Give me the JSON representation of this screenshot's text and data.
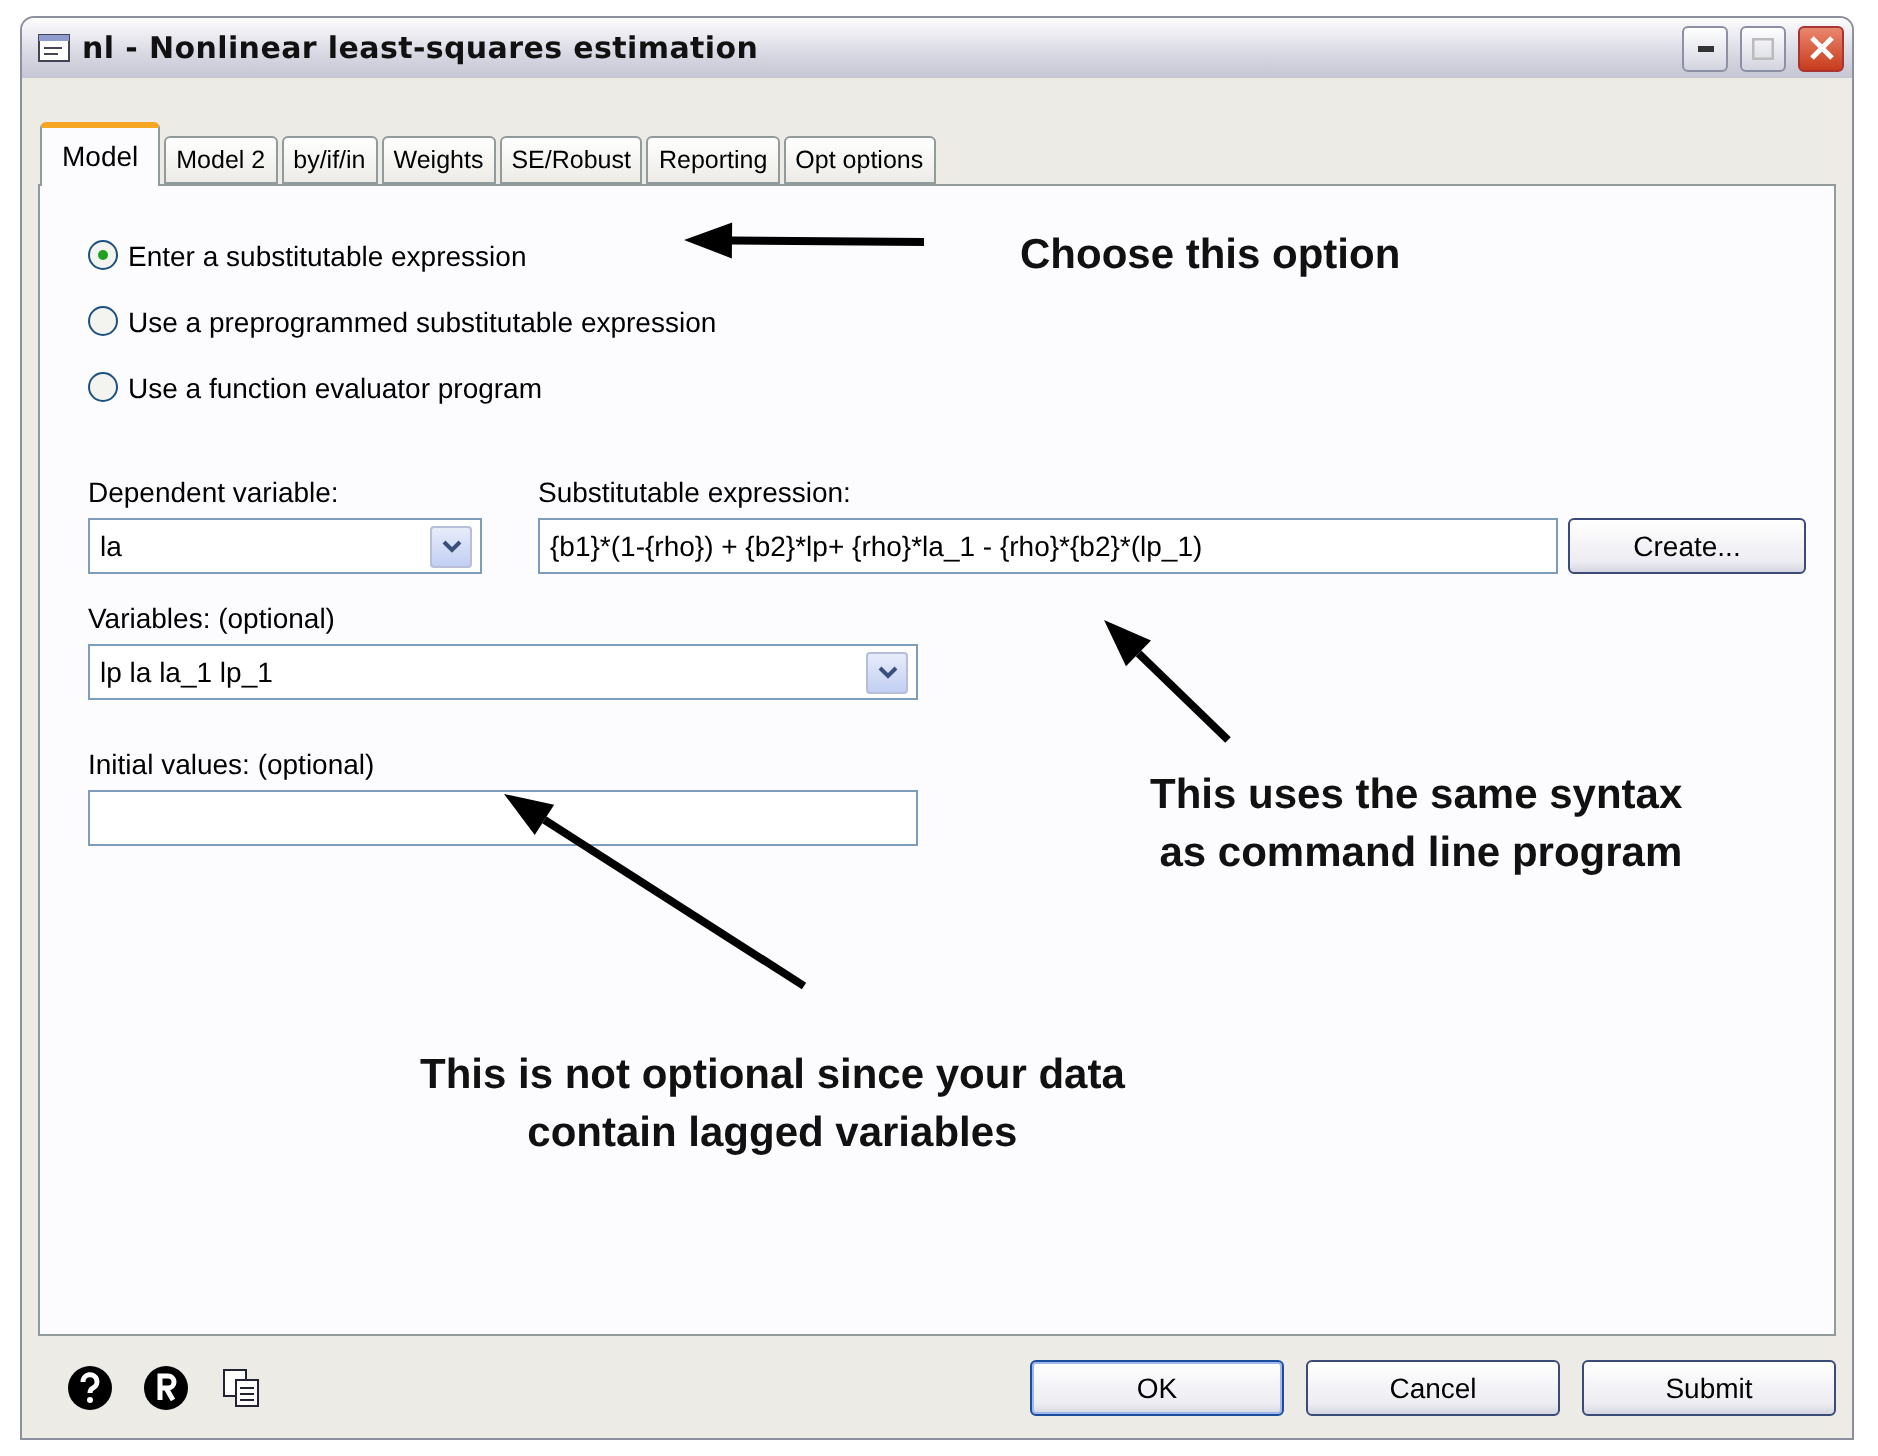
{
  "window": {
    "title": "nl - Nonlinear least-squares estimation"
  },
  "tabs": [
    {
      "label": "Model",
      "selected": true
    },
    {
      "label": "Model 2",
      "selected": false
    },
    {
      "label": "by/if/in",
      "selected": false
    },
    {
      "label": "Weights",
      "selected": false
    },
    {
      "label": "SE/Robust",
      "selected": false
    },
    {
      "label": "Reporting",
      "selected": false
    },
    {
      "label": "Opt options",
      "selected": false
    }
  ],
  "options": [
    {
      "label": "Enter a substitutable expression",
      "selected": true
    },
    {
      "label": "Use a preprogrammed substitutable expression",
      "selected": false
    },
    {
      "label": "Use a function evaluator program",
      "selected": false
    }
  ],
  "dependent_variable": {
    "label": "Dependent variable:",
    "value": "la"
  },
  "substitutable_expression": {
    "label": "Substitutable expression:",
    "value": "{b1}*(1-{rho}) + {b2}*lp+ {rho}*la_1 - {rho}*{b2}*(lp_1)",
    "button": "Create..."
  },
  "variables": {
    "label": "Variables: (optional)",
    "value": "lp la la_1 lp_1"
  },
  "initial_values": {
    "label": "Initial values: (optional)"
  },
  "annotations": [
    {
      "lines": [
        "Choose this option"
      ]
    },
    {
      "lines": [
        "This uses the same syntax",
        "as command line program"
      ]
    },
    {
      "lines": [
        "This is not optional since your data",
        "contain lagged variables"
      ]
    }
  ],
  "buttons": [
    {
      "label": "OK",
      "selected": true
    },
    {
      "label": "Cancel",
      "selected": false
    },
    {
      "label": "Submit",
      "selected": false
    }
  ]
}
